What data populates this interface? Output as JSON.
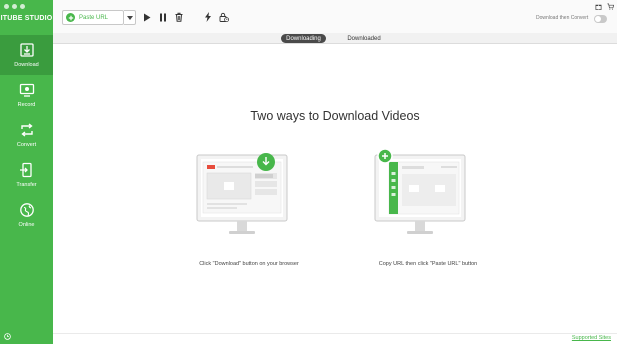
{
  "app": {
    "brand": "ITUBE STUDIO"
  },
  "sidebar": {
    "items": [
      {
        "label": "Download",
        "icon": "download-icon",
        "active": true
      },
      {
        "label": "Record",
        "icon": "record-icon",
        "active": false
      },
      {
        "label": "Convert",
        "icon": "convert-icon",
        "active": false
      },
      {
        "label": "Transfer",
        "icon": "transfer-icon",
        "active": false
      },
      {
        "label": "Online",
        "icon": "online-icon",
        "active": false
      }
    ]
  },
  "toolbar": {
    "paste_url_label": "Paste URL",
    "download_then_convert_label": "Download then Convert",
    "download_then_convert_on": false
  },
  "tabs": [
    {
      "label": "Downloading",
      "active": true
    },
    {
      "label": "Downloaded",
      "active": false
    }
  ],
  "main": {
    "headline": "Two ways to Download Videos",
    "left_caption": "Click \"Download\" button on your browser",
    "right_caption": "Copy URL then click \"Paste URL\" button"
  },
  "footer": {
    "supported_sites_label": "Supported Sites"
  },
  "colors": {
    "accent": "#48b74b",
    "sidebar_active": "#3a9c3e",
    "tab_active": "#4a4a4a"
  }
}
